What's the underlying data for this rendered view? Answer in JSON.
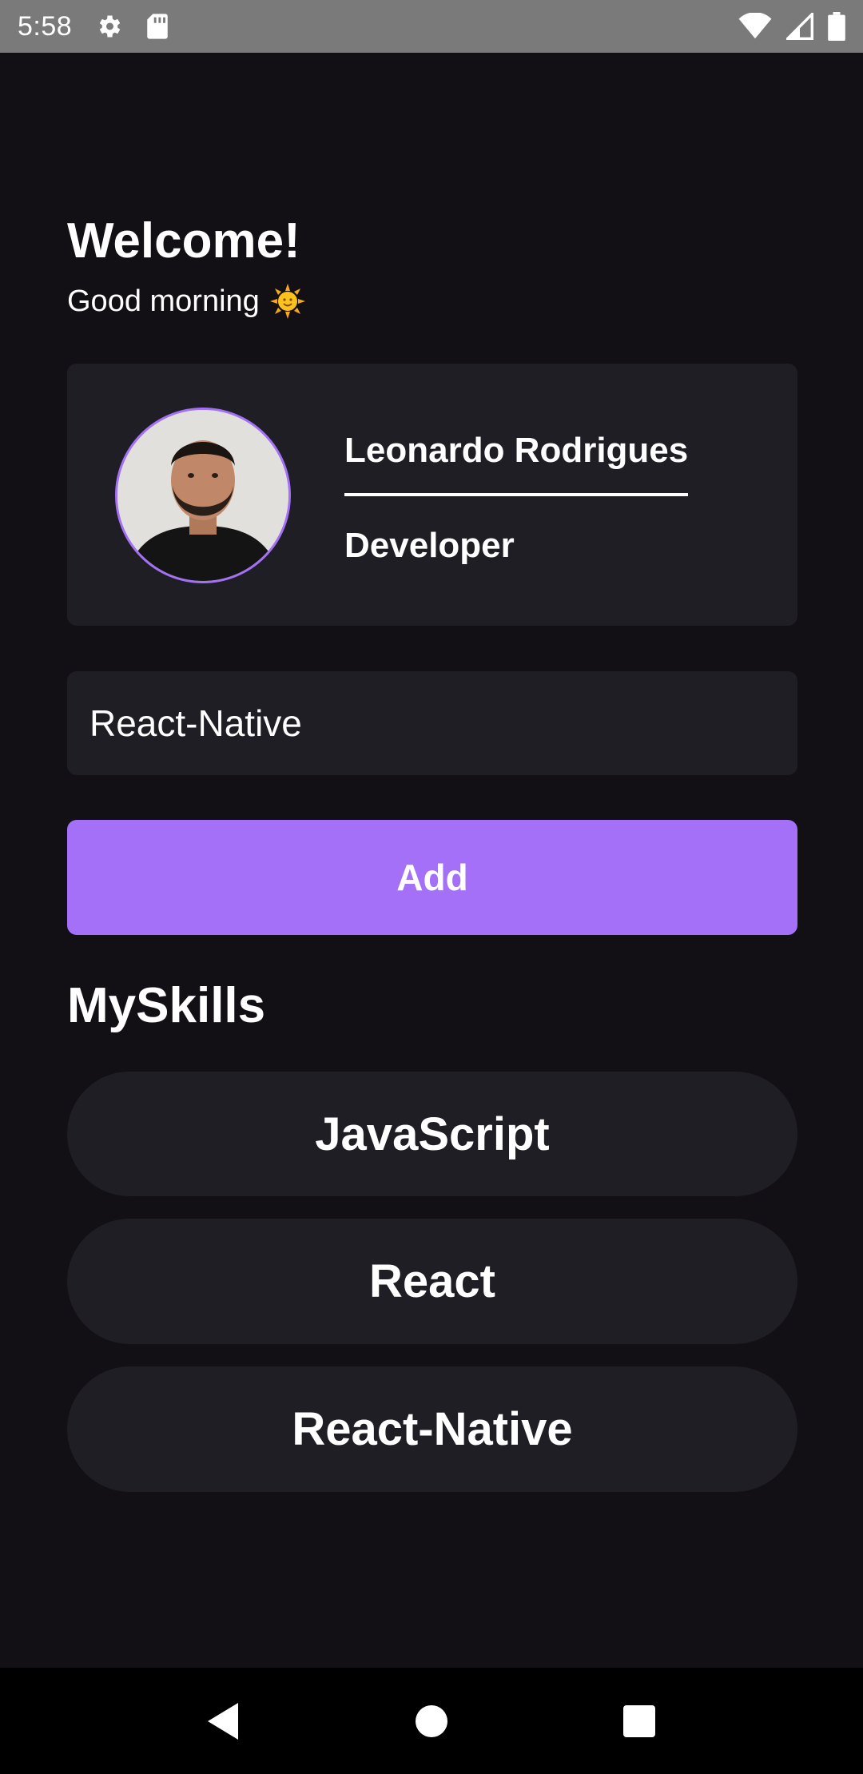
{
  "status_bar": {
    "time": "5:58",
    "icons_left": [
      "gear-icon",
      "sd-card-icon"
    ],
    "icons_right": [
      "wifi-icon",
      "signal-icon",
      "battery-icon"
    ]
  },
  "header": {
    "title": "Welcome!",
    "greeting": "Good morning",
    "greeting_icon": "sun-emoji-icon"
  },
  "profile": {
    "name": "Leonardo Rodrigues",
    "role": "Developer",
    "avatar_icon": "avatar-photo"
  },
  "skill_input": {
    "value": "React-Native",
    "placeholder": ""
  },
  "add_button": {
    "label": "Add"
  },
  "skills_section": {
    "title": "MySkills",
    "items": [
      {
        "label": "JavaScript"
      },
      {
        "label": "React"
      },
      {
        "label": "React-Native"
      }
    ]
  },
  "nav_bar": {
    "buttons": [
      "back-icon",
      "home-icon",
      "recents-icon"
    ]
  },
  "colors": {
    "background": "#121015",
    "card": "#1f1e25",
    "accent": "#a370f7",
    "text": "#ffffff",
    "status_bar": "#7a7a7a",
    "nav_bar": "#000000"
  }
}
